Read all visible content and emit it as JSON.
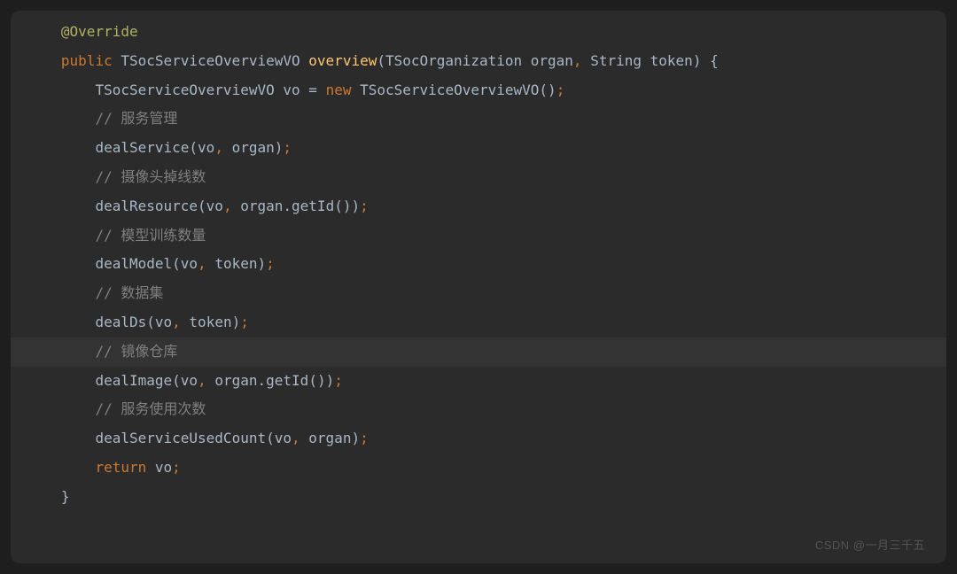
{
  "code": {
    "line1": {
      "annotation": "@Override"
    },
    "line2": {
      "kw_public": "public",
      "type1": "TSocServiceOverviewVO",
      "method": "overview",
      "type2": "TSocOrganization",
      "param1": "organ",
      "type3": "String",
      "param2": "token"
    },
    "line3": {
      "type": "TSocServiceOverviewVO",
      "var": "vo",
      "kw_new": "new",
      "ctor": "TSocServiceOverviewVO"
    },
    "line4": {
      "comment": "// 服务管理"
    },
    "line5": {
      "call": "dealService",
      "a1": "vo",
      "a2": "organ"
    },
    "line6": {
      "comment": "// 摄像头掉线数"
    },
    "line7": {
      "call": "dealResource",
      "a1": "vo",
      "a2": "organ",
      "m2": "getId"
    },
    "line8": {
      "comment": "// 模型训练数量"
    },
    "line9": {
      "call": "dealModel",
      "a1": "vo",
      "a2": "token"
    },
    "line10": {
      "comment": "// 数据集"
    },
    "line11": {
      "call": "dealDs",
      "a1": "vo",
      "a2": "token"
    },
    "line12": {
      "comment": "// 镜像仓库"
    },
    "line13": {
      "call": "dealImage",
      "a1": "vo",
      "a2": "organ",
      "m2": "getId"
    },
    "line14": {
      "comment": "// 服务使用次数"
    },
    "line15": {
      "call": "dealServiceUsedCount",
      "a1": "vo",
      "a2": "organ"
    },
    "line16": {
      "kw_return": "return",
      "var": "vo"
    }
  },
  "watermark": "CSDN @一月三千五"
}
